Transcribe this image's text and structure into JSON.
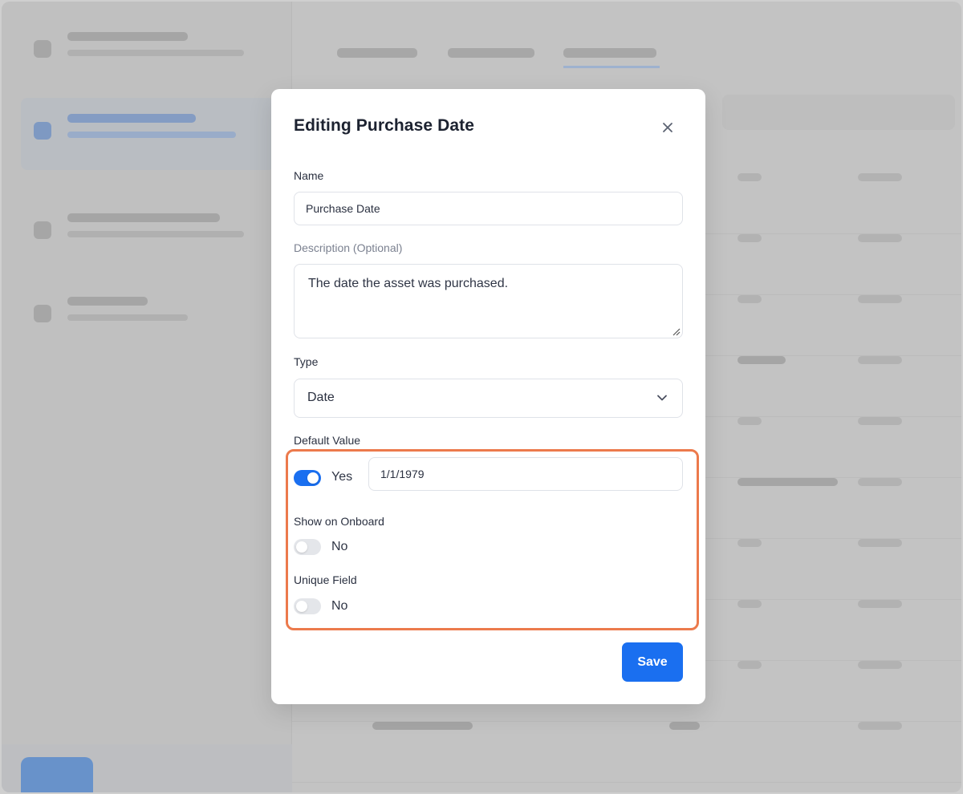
{
  "modal": {
    "title": "Editing Purchase Date",
    "close_icon": "close-icon",
    "name_label": "Name",
    "name_value": "Purchase Date",
    "description_label": "Description (Optional)",
    "description_value": "The date the asset was purchased.",
    "type_label": "Type",
    "type_value": "Date",
    "default_value_label": "Default Value",
    "default_toggle_text": "Yes",
    "default_value": "1/1/1979",
    "show_onboard_label": "Show on Onboard",
    "show_onboard_text": "No",
    "unique_field_label": "Unique Field",
    "unique_field_text": "No",
    "save_label": "Save"
  },
  "colors": {
    "accent": "#1a6ff0",
    "highlight": "#ec7a4c"
  }
}
